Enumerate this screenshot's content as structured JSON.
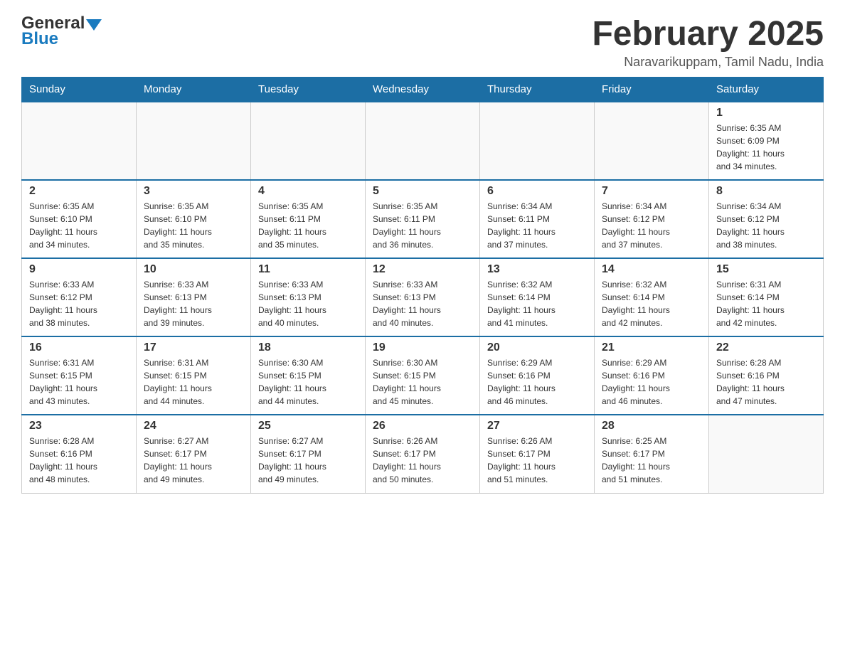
{
  "header": {
    "logo": {
      "general": "General",
      "blue": "Blue",
      "arrow": "▼"
    },
    "title": "February 2025",
    "location": "Naravarikuppam, Tamil Nadu, India"
  },
  "calendar": {
    "days_of_week": [
      "Sunday",
      "Monday",
      "Tuesday",
      "Wednesday",
      "Thursday",
      "Friday",
      "Saturday"
    ],
    "weeks": [
      [
        {
          "day": "",
          "info": ""
        },
        {
          "day": "",
          "info": ""
        },
        {
          "day": "",
          "info": ""
        },
        {
          "day": "",
          "info": ""
        },
        {
          "day": "",
          "info": ""
        },
        {
          "day": "",
          "info": ""
        },
        {
          "day": "1",
          "info": "Sunrise: 6:35 AM\nSunset: 6:09 PM\nDaylight: 11 hours\nand 34 minutes."
        }
      ],
      [
        {
          "day": "2",
          "info": "Sunrise: 6:35 AM\nSunset: 6:10 PM\nDaylight: 11 hours\nand 34 minutes."
        },
        {
          "day": "3",
          "info": "Sunrise: 6:35 AM\nSunset: 6:10 PM\nDaylight: 11 hours\nand 35 minutes."
        },
        {
          "day": "4",
          "info": "Sunrise: 6:35 AM\nSunset: 6:11 PM\nDaylight: 11 hours\nand 35 minutes."
        },
        {
          "day": "5",
          "info": "Sunrise: 6:35 AM\nSunset: 6:11 PM\nDaylight: 11 hours\nand 36 minutes."
        },
        {
          "day": "6",
          "info": "Sunrise: 6:34 AM\nSunset: 6:11 PM\nDaylight: 11 hours\nand 37 minutes."
        },
        {
          "day": "7",
          "info": "Sunrise: 6:34 AM\nSunset: 6:12 PM\nDaylight: 11 hours\nand 37 minutes."
        },
        {
          "day": "8",
          "info": "Sunrise: 6:34 AM\nSunset: 6:12 PM\nDaylight: 11 hours\nand 38 minutes."
        }
      ],
      [
        {
          "day": "9",
          "info": "Sunrise: 6:33 AM\nSunset: 6:12 PM\nDaylight: 11 hours\nand 38 minutes."
        },
        {
          "day": "10",
          "info": "Sunrise: 6:33 AM\nSunset: 6:13 PM\nDaylight: 11 hours\nand 39 minutes."
        },
        {
          "day": "11",
          "info": "Sunrise: 6:33 AM\nSunset: 6:13 PM\nDaylight: 11 hours\nand 40 minutes."
        },
        {
          "day": "12",
          "info": "Sunrise: 6:33 AM\nSunset: 6:13 PM\nDaylight: 11 hours\nand 40 minutes."
        },
        {
          "day": "13",
          "info": "Sunrise: 6:32 AM\nSunset: 6:14 PM\nDaylight: 11 hours\nand 41 minutes."
        },
        {
          "day": "14",
          "info": "Sunrise: 6:32 AM\nSunset: 6:14 PM\nDaylight: 11 hours\nand 42 minutes."
        },
        {
          "day": "15",
          "info": "Sunrise: 6:31 AM\nSunset: 6:14 PM\nDaylight: 11 hours\nand 42 minutes."
        }
      ],
      [
        {
          "day": "16",
          "info": "Sunrise: 6:31 AM\nSunset: 6:15 PM\nDaylight: 11 hours\nand 43 minutes."
        },
        {
          "day": "17",
          "info": "Sunrise: 6:31 AM\nSunset: 6:15 PM\nDaylight: 11 hours\nand 44 minutes."
        },
        {
          "day": "18",
          "info": "Sunrise: 6:30 AM\nSunset: 6:15 PM\nDaylight: 11 hours\nand 44 minutes."
        },
        {
          "day": "19",
          "info": "Sunrise: 6:30 AM\nSunset: 6:15 PM\nDaylight: 11 hours\nand 45 minutes."
        },
        {
          "day": "20",
          "info": "Sunrise: 6:29 AM\nSunset: 6:16 PM\nDaylight: 11 hours\nand 46 minutes."
        },
        {
          "day": "21",
          "info": "Sunrise: 6:29 AM\nSunset: 6:16 PM\nDaylight: 11 hours\nand 46 minutes."
        },
        {
          "day": "22",
          "info": "Sunrise: 6:28 AM\nSunset: 6:16 PM\nDaylight: 11 hours\nand 47 minutes."
        }
      ],
      [
        {
          "day": "23",
          "info": "Sunrise: 6:28 AM\nSunset: 6:16 PM\nDaylight: 11 hours\nand 48 minutes."
        },
        {
          "day": "24",
          "info": "Sunrise: 6:27 AM\nSunset: 6:17 PM\nDaylight: 11 hours\nand 49 minutes."
        },
        {
          "day": "25",
          "info": "Sunrise: 6:27 AM\nSunset: 6:17 PM\nDaylight: 11 hours\nand 49 minutes."
        },
        {
          "day": "26",
          "info": "Sunrise: 6:26 AM\nSunset: 6:17 PM\nDaylight: 11 hours\nand 50 minutes."
        },
        {
          "day": "27",
          "info": "Sunrise: 6:26 AM\nSunset: 6:17 PM\nDaylight: 11 hours\nand 51 minutes."
        },
        {
          "day": "28",
          "info": "Sunrise: 6:25 AM\nSunset: 6:17 PM\nDaylight: 11 hours\nand 51 minutes."
        },
        {
          "day": "",
          "info": ""
        }
      ]
    ]
  }
}
